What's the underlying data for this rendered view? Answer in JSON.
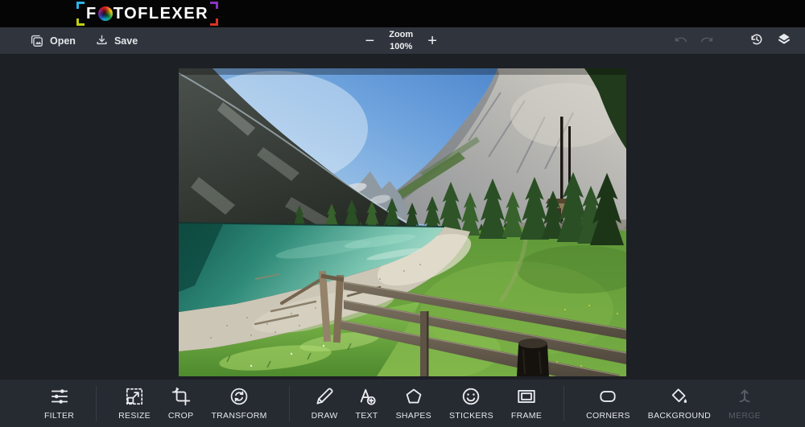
{
  "brand": {
    "name_pre": "F",
    "name_post": "TOFLEXER",
    "bracket_colors": {
      "top_left": "#29b6e8",
      "bottom_left": "#bfd00f",
      "top_right": "#8a34c4",
      "bottom_right": "#da3425"
    }
  },
  "toolbar": {
    "open_label": "Open",
    "save_label": "Save",
    "zoom": {
      "label": "Zoom",
      "value": "100%",
      "out_glyph": "−",
      "in_glyph": "+"
    }
  },
  "tools": [
    {
      "id": "filter",
      "label": "FILTER"
    },
    {
      "id": "resize",
      "label": "RESIZE"
    },
    {
      "id": "crop",
      "label": "CROP"
    },
    {
      "id": "transform",
      "label": "TRANSFORM"
    },
    {
      "id": "draw",
      "label": "DRAW"
    },
    {
      "id": "text",
      "label": "TEXT"
    },
    {
      "id": "shapes",
      "label": "SHAPES"
    },
    {
      "id": "stickers",
      "label": "STICKERS"
    },
    {
      "id": "frame",
      "label": "FRAME"
    },
    {
      "id": "corners",
      "label": "CORNERS"
    },
    {
      "id": "background",
      "label": "BACKGROUND"
    },
    {
      "id": "merge",
      "label": "MERGE",
      "disabled": true
    }
  ],
  "canvas": {
    "image_description": "mountain lake landscape photo with pine trees, pebble beach and wooden fence",
    "zoom_percent": "100%"
  },
  "colors": {
    "top_bar": "#050505",
    "toolbar_bg": "#30343c",
    "canvas_bg": "#1d2025",
    "bottom_bar_bg": "#262a31",
    "icon": "#e8eaed",
    "disabled_icon": "#585d66",
    "lake_teal": "#2f8a78"
  }
}
